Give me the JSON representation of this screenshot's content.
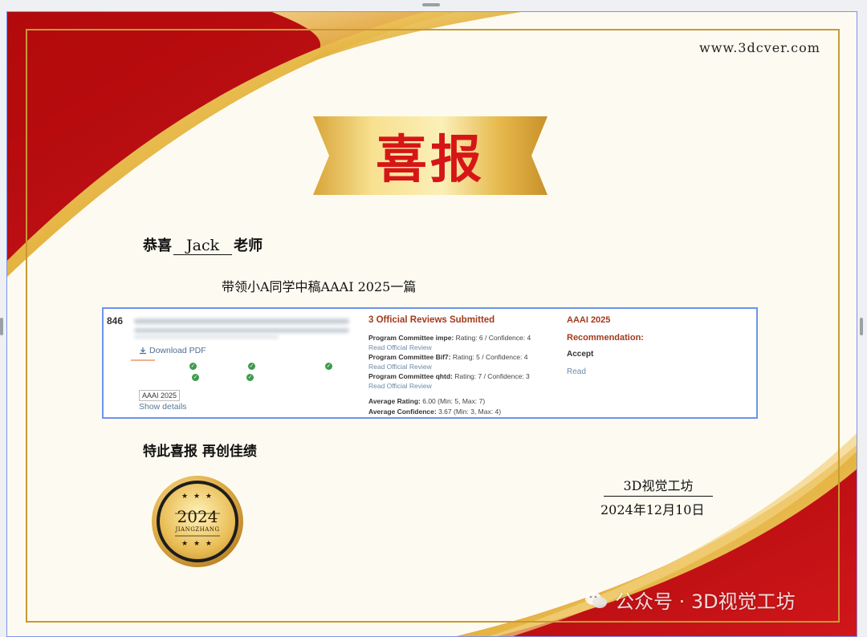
{
  "colors": {
    "red": "#c40f12",
    "gold": "#e7b744",
    "cream": "#fdfbf1",
    "card_border": "#6e93ee"
  },
  "website": "www.3dcver.com",
  "banner": {
    "title": "喜报"
  },
  "congrats": {
    "prefix": "恭喜",
    "name": "Jack",
    "suffix": "老师"
  },
  "subline": "带领小A同学中稿AAAI 2025一篇",
  "card": {
    "paper_id": "846",
    "download_label": "Download PDF",
    "venue_badge": "AAAI 2025",
    "show_details": "Show details",
    "reviews_title": "3 Official Reviews Submitted",
    "reviews": [
      {
        "reviewer": "Program Committee impe:",
        "scores": " Rating: 6 / Confidence: 4",
        "link": "Read Official Review"
      },
      {
        "reviewer": "Program Committee Bif7:",
        "scores": " Rating: 5 / Confidence: 4",
        "link": "Read Official Review"
      },
      {
        "reviewer": "Program Committee qhtd:",
        "scores": " Rating: 7 / Confidence: 3",
        "link": "Read Official Review"
      }
    ],
    "avg_rating_label": "Average Rating:",
    "avg_rating_value": " 6.00 (Min: 5, Max: 7)",
    "avg_conf_label": "Average Confidence:",
    "avg_conf_value": " 3.67 (Min: 3, Max: 4)",
    "decision_venue": "AAAI 2025",
    "recommendation_label": "Recommendation:",
    "decision": "Accept",
    "read_label": "Read"
  },
  "closing": "特此喜报 再创佳绩",
  "signature": {
    "org": "3D视觉工坊",
    "date": "2024年12月10日"
  },
  "medal": {
    "year": "2024",
    "subtitle": "JIANGZHANG",
    "stars": "★ ★ ★"
  },
  "watermark": "公众号 · 3D视觉工坊",
  "icons": [
    "download-icon",
    "check-icon",
    "wechat-icon",
    "star-icon"
  ]
}
